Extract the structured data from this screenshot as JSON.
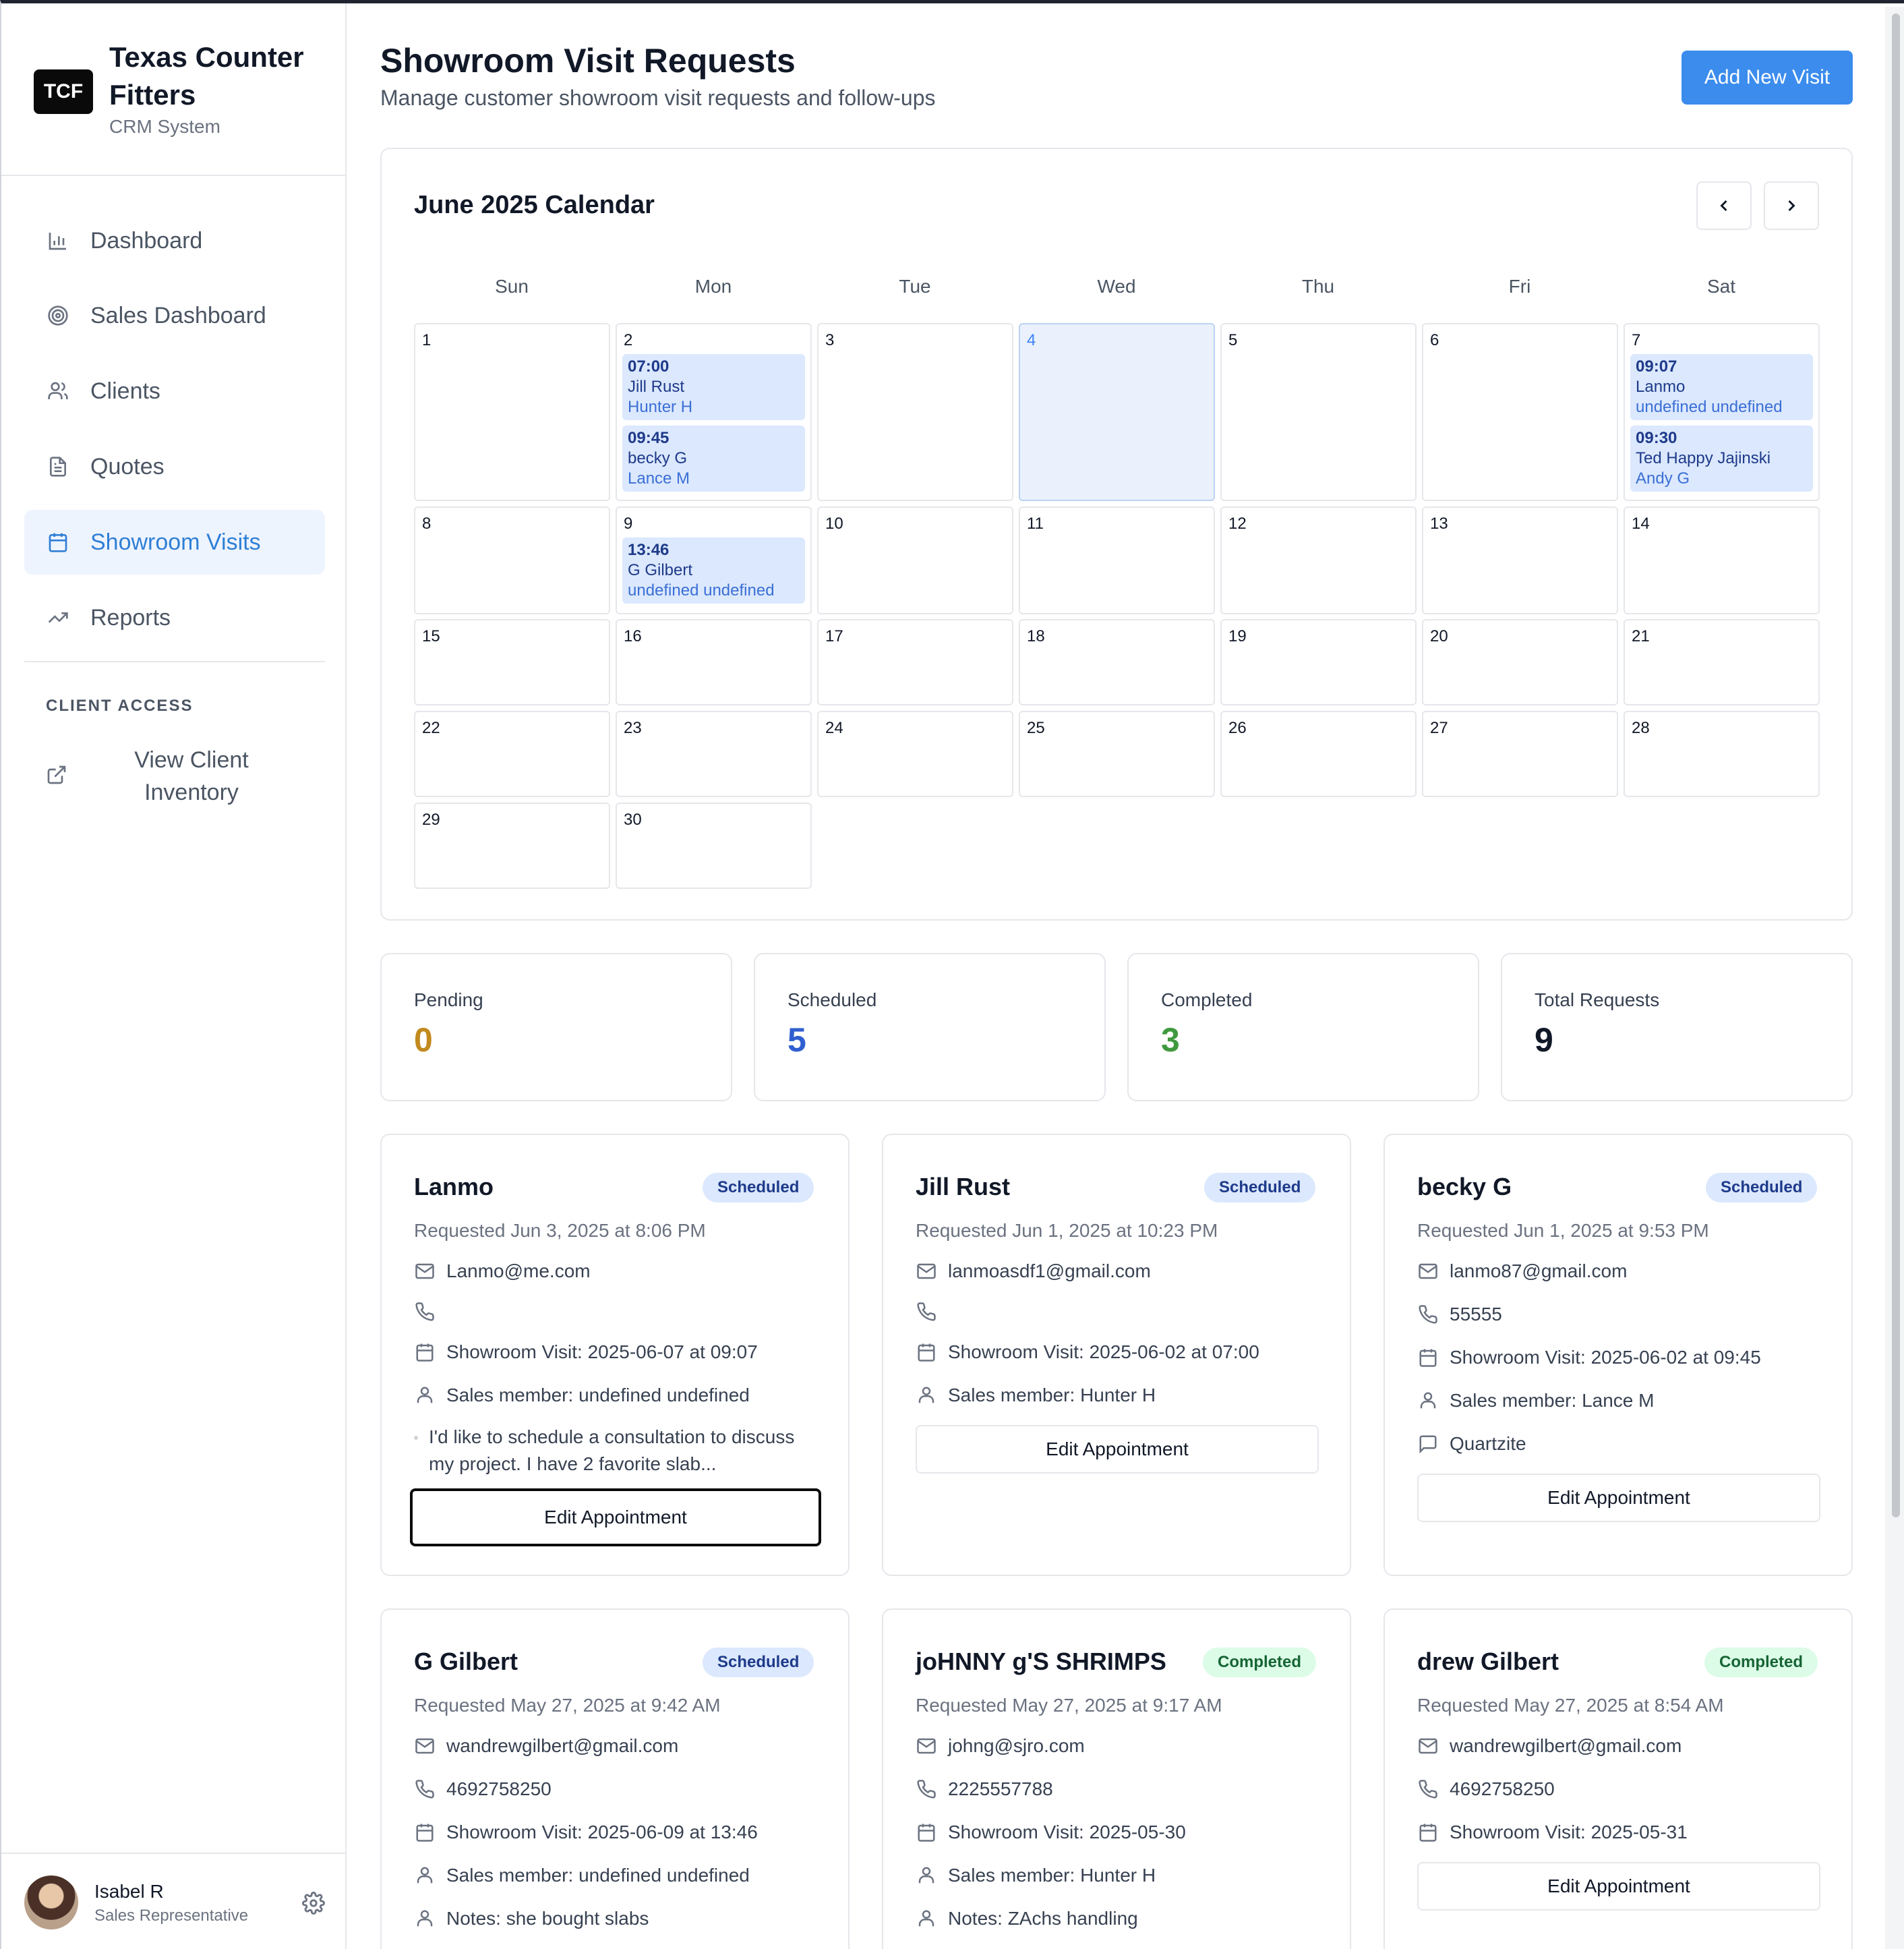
{
  "brand": {
    "logo": "TCF",
    "name": "Texas Counter Fitters",
    "subtitle": "CRM System"
  },
  "nav": {
    "items": [
      {
        "label": "Dashboard",
        "icon": "bar-chart-icon"
      },
      {
        "label": "Sales Dashboard",
        "icon": "target-icon"
      },
      {
        "label": "Clients",
        "icon": "users-icon"
      },
      {
        "label": "Quotes",
        "icon": "document-icon"
      },
      {
        "label": "Showroom Visits",
        "icon": "calendar-icon",
        "active": true
      },
      {
        "label": "Reports",
        "icon": "trending-up-icon"
      }
    ],
    "section_label": "CLIENT ACCESS",
    "external_link": "View Client Inventory"
  },
  "user": {
    "name": "Isabel R",
    "role": "Sales Representative"
  },
  "header": {
    "title": "Showroom Visit Requests",
    "subtitle": "Manage customer showroom visit requests and follow-ups",
    "add_button": "Add New Visit"
  },
  "calendar": {
    "title": "June 2025 Calendar",
    "prev": "‹",
    "next": "›",
    "weekdays": [
      "Sun",
      "Mon",
      "Tue",
      "Wed",
      "Thu",
      "Fri",
      "Sat"
    ],
    "today": 4,
    "days": [
      "1",
      "2",
      "3",
      "4",
      "5",
      "6",
      "7",
      "8",
      "9",
      "10",
      "11",
      "12",
      "13",
      "14",
      "15",
      "16",
      "17",
      "18",
      "19",
      "20",
      "21",
      "22",
      "23",
      "24",
      "25",
      "26",
      "27",
      "28",
      "29",
      "30"
    ],
    "appointments": {
      "d2a": {
        "time": "07:00",
        "client": "Jill Rust",
        "staff": "Hunter H"
      },
      "d2b": {
        "time": "09:45",
        "client": "becky G",
        "staff": "Lance M"
      },
      "d7a": {
        "time": "09:07",
        "client": "Lanmo",
        "staff": "undefined undefined"
      },
      "d7b": {
        "time": "09:30",
        "client": "Ted Happy Jajinski",
        "staff": "Andy G"
      },
      "d9a": {
        "time": "13:46",
        "client": "G Gilbert",
        "staff": "undefined undefined"
      }
    }
  },
  "stats": {
    "pending": {
      "label": "Pending",
      "value": "0",
      "color": "#c28a1e"
    },
    "scheduled": {
      "label": "Scheduled",
      "value": "5",
      "color": "#2f5fd0"
    },
    "completed": {
      "label": "Completed",
      "value": "3",
      "color": "#3f9a3f"
    },
    "total": {
      "label": "Total Requests",
      "value": "9",
      "color": "#111827"
    }
  },
  "visits": {
    "v1": {
      "name": "Lanmo",
      "status": "Scheduled",
      "requested": "Requested Jun 3, 2025 at 8:06 PM",
      "email": "Lanmo@me.com",
      "phone": "",
      "visit": "Showroom Visit: 2025-06-07 at 09:07",
      "sales": "Sales member: undefined undefined",
      "note": "I'd like to schedule a consultation to discuss my project. I have 2 favorite slab...",
      "edit": "Edit Appointment"
    },
    "v2": {
      "name": "Jill Rust",
      "status": "Scheduled",
      "requested": "Requested Jun 1, 2025 at 10:23 PM",
      "email": "lanmoasdf1@gmail.com",
      "phone": "",
      "visit": "Showroom Visit: 2025-06-02 at 07:00",
      "sales": "Sales member: Hunter H",
      "edit": "Edit Appointment"
    },
    "v3": {
      "name": "becky G",
      "status": "Scheduled",
      "requested": "Requested Jun 1, 2025 at 9:53 PM",
      "email": "lanmo87@gmail.com",
      "phone": "55555",
      "visit": "Showroom Visit: 2025-06-02 at 09:45",
      "sales": "Sales member: Lance M",
      "comment": "Quartzite",
      "edit": "Edit Appointment"
    },
    "v4": {
      "name": "G Gilbert",
      "status": "Scheduled",
      "requested": "Requested May 27, 2025 at 9:42 AM",
      "email": "wandrewgilbert@gmail.com",
      "phone": "4692758250",
      "visit": "Showroom Visit: 2025-06-09 at 13:46",
      "sales": "Sales member: undefined undefined",
      "notes": "Notes: she bought slabs"
    },
    "v5": {
      "name": "joHNNY g'S SHRIMPS",
      "status": "Completed",
      "requested": "Requested May 27, 2025 at 9:17 AM",
      "email": "johng@sjro.com",
      "phone": "2225557788",
      "visit": "Showroom Visit: 2025-05-30",
      "sales": "Sales member: Hunter H",
      "notes": "Notes: ZAchs handling"
    },
    "v6": {
      "name": "drew Gilbert",
      "status": "Completed",
      "requested": "Requested May 27, 2025 at 8:54 AM",
      "email": "wandrewgilbert@gmail.com",
      "phone": "4692758250",
      "visit": "Showroom Visit: 2025-05-31",
      "edit": "Edit Appointment"
    }
  }
}
